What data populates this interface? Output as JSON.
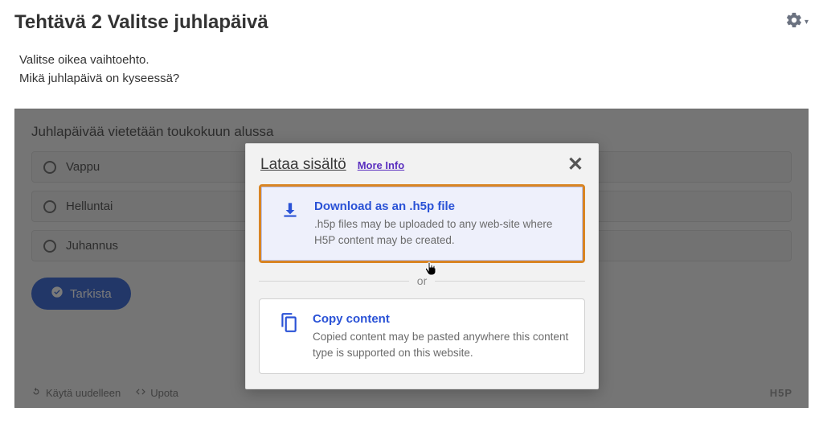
{
  "header": {
    "title": "Tehtävä 2 Valitse juhlapäivä"
  },
  "question": {
    "line1": "Valitse oikea vaihtoehto.",
    "line2": "Mikä juhlapäivä on kyseessä?"
  },
  "quiz": {
    "heading": "Juhlapäivää vietetään toukokuun alussa",
    "options": [
      "Vappu",
      "Helluntai",
      "Juhannus"
    ],
    "check_label": "Tarkista"
  },
  "footer": {
    "reuse_label": "Käytä uudelleen",
    "embed_label": "Upota",
    "brand": "H5P"
  },
  "modal": {
    "title": "Lataa sisältö",
    "more_info": "More Info",
    "download": {
      "title": "Download as an .h5p file",
      "desc": ".h5p files may be uploaded to any web-site where H5P content may be created."
    },
    "or": "or",
    "copy": {
      "title": "Copy content",
      "desc": "Copied content may be pasted anywhere this content type is supported on this website."
    }
  }
}
